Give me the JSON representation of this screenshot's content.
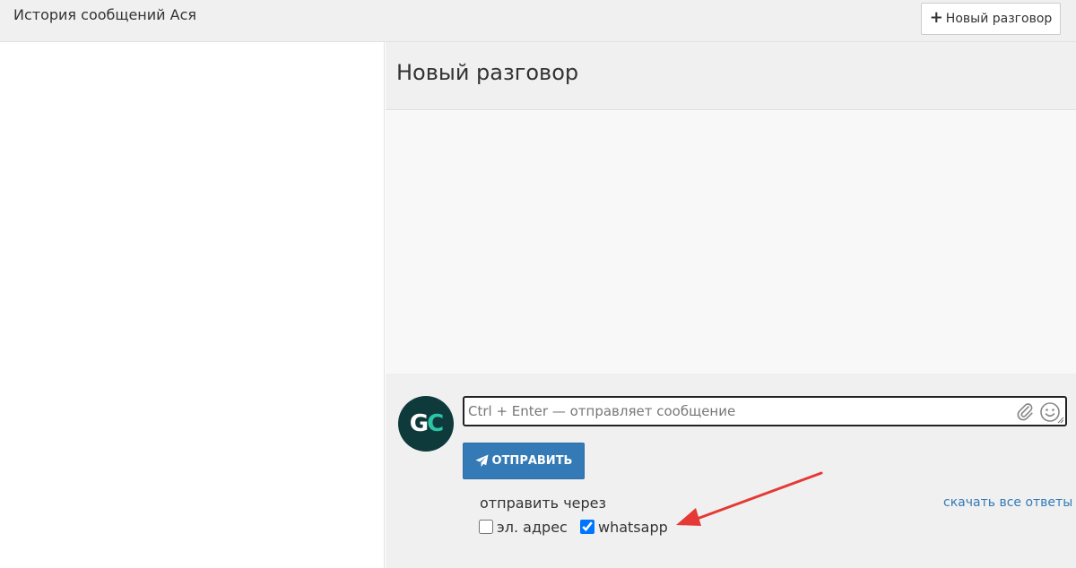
{
  "topbar": {
    "title": "История сообщений Ася",
    "new_conversation_label": "Новый разговор"
  },
  "conversation": {
    "heading": "Новый разговор"
  },
  "composer": {
    "avatar_initials": [
      "G",
      "C"
    ],
    "input_placeholder": "Ctrl + Enter — отправляет сообщение",
    "input_value": "",
    "send_label": "ОТПРАВИТЬ",
    "send_via_label": "отправить через",
    "download_link": "скачать все ответы",
    "channels": [
      {
        "label": "эл. адрес",
        "checked": false
      },
      {
        "label": "whatsapp",
        "checked": true
      }
    ]
  },
  "colors": {
    "primary": "#337ab7",
    "avatar_bg": "#0f3a3c",
    "avatar_accent": "#2ec4a6",
    "annotation_arrow": "#e53935"
  },
  "icons": [
    "plus-icon",
    "paperclip-icon",
    "smiley-icon",
    "paper-plane-icon",
    "annotation-arrow-icon"
  ]
}
